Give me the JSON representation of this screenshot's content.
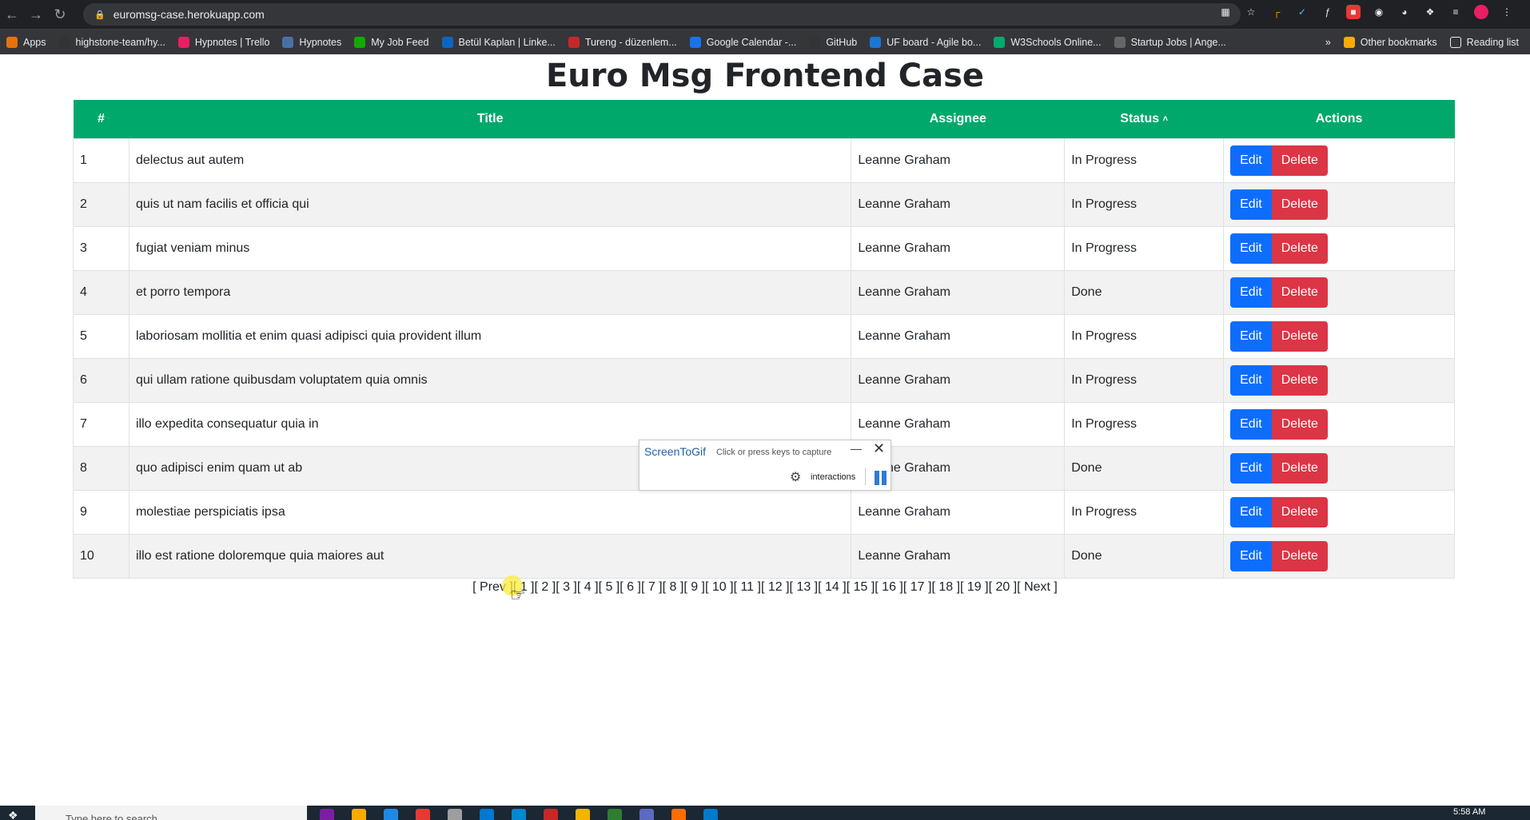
{
  "browser": {
    "url": "euromsg-case.herokuapp.com",
    "bookmarks": [
      {
        "label": "Apps",
        "color": "#e8710a"
      },
      {
        "label": "highstone-team/hy...",
        "color": "#333"
      },
      {
        "label": "Hypnotes | Trello",
        "color": "#e91e63"
      },
      {
        "label": "Hypnotes",
        "color": "#4a6fa5"
      },
      {
        "label": "My Job Feed",
        "color": "#14a800"
      },
      {
        "label": "Betül Kaplan | Linke...",
        "color": "#0a66c2"
      },
      {
        "label": "Tureng - düzenlem...",
        "color": "#c62828"
      },
      {
        "label": "Google Calendar -...",
        "color": "#1a73e8"
      },
      {
        "label": "GitHub",
        "color": "#333"
      },
      {
        "label": "UF board - Agile bo...",
        "color": "#1976d2"
      },
      {
        "label": "W3Schools Online...",
        "color": "#04aa6d"
      },
      {
        "label": "Startup Jobs | Ange...",
        "color": "#666"
      }
    ],
    "more_label": "»",
    "other_bookmarks": "Other bookmarks",
    "reading_list": "Reading list"
  },
  "page": {
    "title": "Euro Msg Frontend Case",
    "columns": [
      "#",
      "Title",
      "Assignee",
      "Status",
      "Actions"
    ],
    "sort_indicator": "^",
    "edit_label": "Edit",
    "delete_label": "Delete",
    "rows": [
      {
        "id": "1",
        "title": "delectus aut autem",
        "assignee": "Leanne Graham",
        "status": "In Progress"
      },
      {
        "id": "2",
        "title": "quis ut nam facilis et officia qui",
        "assignee": "Leanne Graham",
        "status": "In Progress"
      },
      {
        "id": "3",
        "title": "fugiat veniam minus",
        "assignee": "Leanne Graham",
        "status": "In Progress"
      },
      {
        "id": "4",
        "title": "et porro tempora",
        "assignee": "Leanne Graham",
        "status": "Done"
      },
      {
        "id": "5",
        "title": "laboriosam mollitia et enim quasi adipisci quia provident illum",
        "assignee": "Leanne Graham",
        "status": "In Progress"
      },
      {
        "id": "6",
        "title": "qui ullam ratione quibusdam voluptatem quia omnis",
        "assignee": "Leanne Graham",
        "status": "In Progress"
      },
      {
        "id": "7",
        "title": "illo expedita consequatur quia in",
        "assignee": "Leanne Graham",
        "status": "In Progress"
      },
      {
        "id": "8",
        "title": "quo adipisci enim quam ut ab",
        "assignee": "Leanne Graham",
        "status": "Done"
      },
      {
        "id": "9",
        "title": "molestiae perspiciatis ipsa",
        "assignee": "Leanne Graham",
        "status": "In Progress"
      },
      {
        "id": "10",
        "title": "illo est ratione doloremque quia maiores aut",
        "assignee": "Leanne Graham",
        "status": "Done"
      }
    ],
    "pagination": [
      "Prev",
      "1",
      "2",
      "3",
      "4",
      "5",
      "6",
      "7",
      "8",
      "9",
      "10",
      "11",
      "12",
      "13",
      "14",
      "15",
      "16",
      "17",
      "18",
      "19",
      "20",
      "Next"
    ]
  },
  "overlay": {
    "title": "ScreenToGif",
    "hint": "Click or press keys to capture",
    "interactions_label": "interactions"
  },
  "taskbar": {
    "search_placeholder": "Type here to search",
    "time": "5:58 AM"
  },
  "colors": {
    "header_green": "#00a86b",
    "edit_blue": "#0d6efd",
    "delete_red": "#dc3545"
  }
}
